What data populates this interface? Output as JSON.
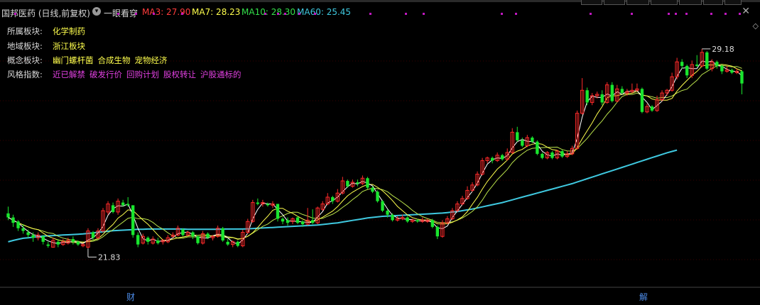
{
  "header": {
    "title": "国邦医药 (日线,前复权)",
    "eye_label": "一眼看穿",
    "ma": [
      {
        "label": "MA3: 27.90",
        "color": "#ff3b3b"
      },
      {
        "label": "MA7: 28.23",
        "color": "#ffff4d"
      },
      {
        "label": "MA10: 28.30",
        "color": "#33e04a"
      },
      {
        "label": "MA60: 25.45",
        "color": "#3fc9e0"
      }
    ]
  },
  "info_board": [
    {
      "key": "所属板块:",
      "values": [
        "化学制药"
      ],
      "color": "#ffff4d"
    },
    {
      "key": "地域板块:",
      "values": [
        "浙江板块"
      ],
      "color": "#ffff4d"
    },
    {
      "key": "概念板块:",
      "values": [
        "幽门螺杆菌",
        "合成生物",
        "宠物经济"
      ],
      "color": "#ffff4d"
    },
    {
      "key": "风格指数:",
      "values": [
        "近已解禁",
        "破发行价",
        "回购计划",
        "股权转让",
        "沪股通标的"
      ],
      "color": "#e040e0"
    }
  ],
  "markers": {
    "finance": "财",
    "unlock": "解"
  },
  "chart_data": {
    "type": "candlestick",
    "price_range": [
      20.5,
      30.2
    ],
    "high_label": "29.18",
    "low_label": "21.83",
    "colors": {
      "up": "#ff2a2a",
      "down": "#19e62e",
      "ma3": "#ffffff",
      "ma7": "#ffff4d",
      "ma10": "#b8e04a",
      "ma60": "#3fc9e0"
    },
    "candles": [
      [
        23.1,
        22.95,
        23.35,
        22.85
      ],
      [
        22.95,
        22.75,
        23.05,
        22.6
      ],
      [
        22.8,
        22.55,
        22.85,
        22.45
      ],
      [
        22.55,
        22.45,
        22.7,
        22.35
      ],
      [
        22.4,
        22.3,
        22.5,
        22.2
      ],
      [
        22.3,
        22.2,
        22.4,
        22.05
      ],
      [
        22.2,
        22.3,
        22.4,
        22.1
      ],
      [
        22.25,
        22.05,
        22.3,
        21.95
      ],
      [
        21.95,
        21.9,
        22.05,
        21.83
      ],
      [
        21.85,
        22.1,
        22.2,
        21.83
      ],
      [
        22.05,
        21.95,
        22.15,
        21.85
      ],
      [
        21.95,
        22.05,
        22.15,
        21.9
      ],
      [
        22.0,
        22.1,
        22.2,
        21.95
      ],
      [
        22.15,
        22.05,
        22.25,
        21.95
      ],
      [
        22.05,
        21.95,
        22.1,
        21.9
      ],
      [
        21.9,
        21.95,
        22.0,
        21.85
      ],
      [
        21.85,
        22.45,
        22.55,
        21.8
      ],
      [
        22.4,
        22.2,
        22.45,
        22.1
      ],
      [
        22.2,
        22.45,
        22.55,
        22.15
      ],
      [
        22.45,
        23.2,
        23.3,
        22.4
      ],
      [
        23.15,
        23.45,
        23.55,
        23.05
      ],
      [
        23.4,
        23.15,
        23.5,
        23.1
      ],
      [
        23.15,
        23.55,
        23.65,
        23.05
      ],
      [
        23.5,
        23.4,
        23.6,
        23.35
      ],
      [
        23.45,
        23.4,
        23.7,
        23.35
      ],
      [
        23.4,
        22.3,
        23.4,
        22.2
      ],
      [
        22.3,
        21.95,
        22.4,
        21.85
      ],
      [
        22.0,
        22.25,
        22.35,
        21.95
      ],
      [
        22.2,
        22.05,
        22.25,
        21.95
      ],
      [
        22.0,
        22.15,
        22.25,
        21.95
      ],
      [
        22.1,
        22.0,
        22.2,
        21.95
      ],
      [
        22.05,
        22.1,
        22.15,
        21.95
      ],
      [
        22.05,
        22.2,
        22.3,
        22.0
      ],
      [
        22.25,
        22.3,
        22.4,
        22.2
      ],
      [
        22.3,
        22.55,
        22.65,
        22.25
      ],
      [
        22.5,
        22.3,
        22.55,
        22.25
      ],
      [
        22.3,
        22.4,
        22.45,
        22.25
      ],
      [
        22.4,
        22.25,
        22.45,
        22.15
      ],
      [
        22.25,
        22.0,
        22.3,
        21.95
      ],
      [
        22.0,
        22.35,
        22.45,
        21.95
      ],
      [
        22.35,
        22.2,
        22.4,
        22.15
      ],
      [
        22.2,
        22.25,
        22.3,
        22.1
      ],
      [
        22.25,
        22.55,
        22.65,
        22.2
      ],
      [
        22.55,
        22.1,
        22.6,
        22.05
      ],
      [
        22.05,
        21.95,
        22.15,
        21.9
      ],
      [
        21.95,
        22.05,
        22.1,
        21.85
      ],
      [
        22.05,
        21.9,
        22.1,
        21.85
      ],
      [
        21.9,
        22.4,
        22.5,
        21.85
      ],
      [
        22.4,
        22.8,
        22.9,
        22.35
      ],
      [
        22.8,
        23.5,
        23.6,
        22.75
      ],
      [
        23.5,
        23.45,
        23.65,
        23.4
      ],
      [
        23.45,
        23.5,
        23.6,
        23.35
      ],
      [
        23.45,
        23.4,
        23.5,
        23.35
      ],
      [
        23.4,
        23.45,
        23.55,
        23.3
      ],
      [
        23.45,
        22.9,
        23.45,
        22.8
      ],
      [
        22.9,
        22.8,
        22.95,
        22.7
      ],
      [
        22.85,
        22.75,
        22.95,
        22.65
      ],
      [
        22.8,
        22.9,
        22.95,
        22.7
      ],
      [
        22.95,
        22.75,
        23.0,
        22.7
      ],
      [
        22.8,
        22.7,
        22.85,
        22.6
      ],
      [
        22.7,
        22.85,
        23.3,
        22.65
      ],
      [
        22.85,
        22.75,
        23.25,
        22.7
      ],
      [
        22.75,
        23.3,
        23.35,
        22.7
      ],
      [
        23.25,
        23.45,
        23.55,
        23.2
      ],
      [
        23.45,
        23.7,
        23.85,
        23.4
      ],
      [
        23.7,
        23.55,
        23.75,
        23.45
      ],
      [
        23.55,
        23.85,
        24.0,
        23.5
      ],
      [
        23.85,
        24.3,
        24.45,
        23.8
      ],
      [
        24.3,
        24.1,
        24.35,
        24.05
      ],
      [
        24.1,
        24.25,
        24.35,
        24.05
      ],
      [
        24.25,
        24.2,
        24.35,
        24.1
      ],
      [
        24.2,
        24.4,
        24.5,
        24.15
      ],
      [
        24.4,
        24.05,
        24.45,
        24.0
      ],
      [
        24.05,
        23.9,
        24.1,
        23.85
      ],
      [
        23.9,
        23.55,
        23.95,
        23.5
      ],
      [
        23.55,
        23.2,
        23.6,
        23.15
      ],
      [
        23.2,
        23.05,
        23.25,
        22.95
      ],
      [
        23.05,
        22.85,
        23.1,
        22.8
      ],
      [
        22.85,
        22.9,
        23.0,
        22.8
      ],
      [
        22.9,
        22.95,
        23.05,
        22.85
      ],
      [
        22.95,
        22.8,
        23.0,
        22.75
      ],
      [
        22.8,
        22.85,
        22.9,
        22.75
      ],
      [
        22.85,
        22.8,
        22.9,
        22.75
      ],
      [
        22.8,
        22.85,
        22.95,
        22.75
      ],
      [
        22.8,
        22.85,
        22.9,
        22.75
      ],
      [
        22.85,
        22.6,
        22.9,
        22.55
      ],
      [
        22.6,
        22.25,
        22.65,
        22.15
      ],
      [
        22.25,
        22.75,
        22.85,
        22.2
      ],
      [
        22.75,
        22.9,
        23.0,
        22.7
      ],
      [
        22.9,
        23.2,
        23.3,
        22.85
      ],
      [
        23.2,
        23.45,
        23.55,
        23.15
      ],
      [
        23.45,
        23.65,
        23.75,
        23.4
      ],
      [
        23.65,
        23.95,
        24.1,
        23.6
      ],
      [
        23.95,
        24.15,
        24.25,
        23.9
      ],
      [
        24.15,
        24.55,
        24.65,
        24.1
      ],
      [
        24.55,
        25.05,
        25.15,
        24.5
      ],
      [
        25.05,
        25.15,
        25.2,
        24.95
      ],
      [
        25.15,
        25.05,
        25.2,
        24.95
      ],
      [
        25.05,
        25.25,
        25.35,
        25.0
      ],
      [
        25.25,
        25.1,
        25.3,
        25.05
      ],
      [
        25.1,
        25.35,
        25.5,
        25.05
      ],
      [
        25.35,
        26.1,
        26.25,
        25.3
      ],
      [
        26.1,
        25.8,
        26.3,
        25.75
      ],
      [
        25.8,
        25.6,
        25.9,
        25.55
      ],
      [
        25.6,
        25.9,
        26.0,
        25.55
      ],
      [
        25.9,
        25.75,
        25.95,
        25.7
      ],
      [
        25.75,
        25.3,
        25.8,
        25.25
      ],
      [
        25.3,
        25.15,
        25.35,
        25.1
      ],
      [
        25.15,
        25.35,
        25.4,
        25.1
      ],
      [
        25.35,
        25.15,
        25.4,
        25.1
      ],
      [
        25.15,
        25.4,
        25.45,
        25.1
      ],
      [
        25.4,
        25.2,
        25.45,
        25.15
      ],
      [
        25.2,
        25.3,
        25.4,
        25.15
      ],
      [
        25.3,
        25.5,
        25.6,
        25.25
      ],
      [
        25.5,
        26.8,
        26.9,
        25.45
      ],
      [
        26.8,
        27.65,
        28.1,
        26.75
      ],
      [
        27.65,
        27.2,
        27.75,
        27.1
      ],
      [
        27.2,
        27.45,
        27.55,
        27.1
      ],
      [
        27.45,
        27.5,
        27.6,
        27.35
      ],
      [
        27.5,
        27.2,
        27.65,
        27.1
      ],
      [
        27.2,
        27.85,
        27.95,
        27.15
      ],
      [
        27.85,
        27.25,
        27.95,
        27.2
      ],
      [
        27.25,
        27.7,
        27.85,
        27.2
      ],
      [
        27.7,
        27.55,
        27.8,
        27.5
      ],
      [
        27.55,
        27.6,
        27.7,
        27.45
      ],
      [
        27.6,
        27.65,
        27.9,
        27.55
      ],
      [
        27.65,
        27.7,
        27.9,
        27.6
      ],
      [
        27.7,
        26.85,
        27.75,
        26.8
      ],
      [
        26.85,
        27.05,
        27.15,
        26.8
      ],
      [
        27.05,
        26.9,
        27.1,
        26.85
      ],
      [
        26.9,
        27.3,
        27.45,
        26.85
      ],
      [
        27.3,
        27.55,
        27.65,
        27.25
      ],
      [
        27.55,
        27.65,
        27.7,
        27.45
      ],
      [
        27.65,
        28.15,
        28.3,
        27.6
      ],
      [
        28.15,
        28.7,
        28.85,
        28.05
      ],
      [
        28.7,
        28.55,
        28.8,
        28.45
      ],
      [
        28.55,
        28.2,
        28.6,
        28.1
      ],
      [
        28.2,
        28.6,
        28.75,
        28.1
      ],
      [
        28.6,
        28.55,
        28.95,
        28.5
      ],
      [
        28.55,
        29.05,
        29.18,
        28.5
      ],
      [
        29.05,
        28.45,
        29.1,
        28.4
      ],
      [
        28.45,
        28.7,
        28.8,
        28.35
      ],
      [
        28.7,
        28.55,
        28.75,
        28.45
      ],
      [
        28.55,
        28.35,
        28.6,
        28.25
      ],
      [
        28.35,
        28.4,
        28.55,
        28.3
      ],
      [
        28.4,
        28.3,
        28.45,
        28.25
      ],
      [
        28.3,
        28.35,
        28.45,
        28.25
      ],
      [
        28.35,
        27.9,
        28.4,
        27.5
      ]
    ],
    "ma60": [
      22.05,
      22.1,
      22.14,
      22.18,
      22.2,
      22.22,
      22.24,
      22.26,
      22.27,
      22.28,
      22.29,
      22.3,
      22.31,
      22.32,
      22.33,
      22.34,
      22.36,
      22.38,
      22.4,
      22.42,
      22.44,
      22.46,
      22.47,
      22.48,
      22.49,
      22.5,
      22.51,
      22.51,
      22.52,
      22.52,
      22.52,
      22.52,
      22.52,
      22.52,
      22.52,
      22.52,
      22.51,
      22.51,
      22.51,
      22.51,
      22.51,
      22.51,
      22.51,
      22.52,
      22.52,
      22.52,
      22.52,
      22.52,
      22.53,
      22.54,
      22.55,
      22.56,
      22.57,
      22.58,
      22.59,
      22.6,
      22.61,
      22.62,
      22.63,
      22.64,
      22.65,
      22.66,
      22.67,
      22.69,
      22.71,
      22.73,
      22.75,
      22.78,
      22.81,
      22.84,
      22.87,
      22.9,
      22.93,
      22.95,
      22.97,
      22.99,
      23.0,
      23.01,
      23.02,
      23.03,
      23.04,
      23.05,
      23.06,
      23.07,
      23.08,
      23.09,
      23.1,
      23.11,
      23.13,
      23.15,
      23.17,
      23.2,
      23.23,
      23.26,
      23.3,
      23.34,
      23.38,
      23.42,
      23.46,
      23.5,
      23.55,
      23.6,
      23.65,
      23.7,
      23.75,
      23.8,
      23.85,
      23.9,
      23.95,
      24.0,
      24.05,
      24.1,
      24.15,
      24.2,
      24.26,
      24.32,
      24.38,
      24.44,
      24.5,
      24.56,
      24.62,
      24.68,
      24.74,
      24.8,
      24.86,
      24.92,
      24.98,
      25.04,
      25.1,
      25.16,
      25.22,
      25.28,
      25.34,
      25.39,
      25.44
    ]
  }
}
